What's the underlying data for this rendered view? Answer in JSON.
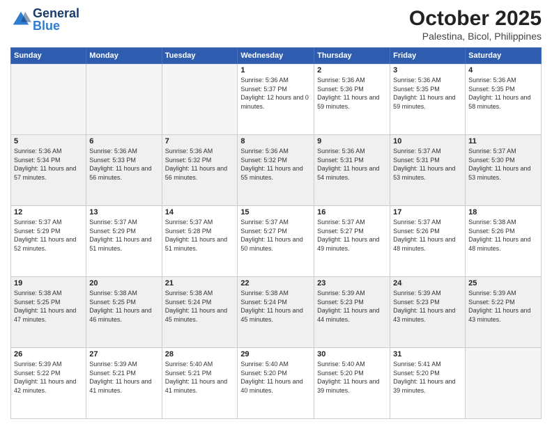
{
  "header": {
    "logo_general": "General",
    "logo_blue": "Blue",
    "month_title": "October 2025",
    "location": "Palestina, Bicol, Philippines"
  },
  "days_of_week": [
    "Sunday",
    "Monday",
    "Tuesday",
    "Wednesday",
    "Thursday",
    "Friday",
    "Saturday"
  ],
  "weeks": [
    [
      {
        "day": "",
        "sunrise": "",
        "sunset": "",
        "daylight": ""
      },
      {
        "day": "",
        "sunrise": "",
        "sunset": "",
        "daylight": ""
      },
      {
        "day": "",
        "sunrise": "",
        "sunset": "",
        "daylight": ""
      },
      {
        "day": "1",
        "sunrise": "Sunrise: 5:36 AM",
        "sunset": "Sunset: 5:37 PM",
        "daylight": "Daylight: 12 hours and 0 minutes."
      },
      {
        "day": "2",
        "sunrise": "Sunrise: 5:36 AM",
        "sunset": "Sunset: 5:36 PM",
        "daylight": "Daylight: 11 hours and 59 minutes."
      },
      {
        "day": "3",
        "sunrise": "Sunrise: 5:36 AM",
        "sunset": "Sunset: 5:35 PM",
        "daylight": "Daylight: 11 hours and 59 minutes."
      },
      {
        "day": "4",
        "sunrise": "Sunrise: 5:36 AM",
        "sunset": "Sunset: 5:35 PM",
        "daylight": "Daylight: 11 hours and 58 minutes."
      }
    ],
    [
      {
        "day": "5",
        "sunrise": "Sunrise: 5:36 AM",
        "sunset": "Sunset: 5:34 PM",
        "daylight": "Daylight: 11 hours and 57 minutes."
      },
      {
        "day": "6",
        "sunrise": "Sunrise: 5:36 AM",
        "sunset": "Sunset: 5:33 PM",
        "daylight": "Daylight: 11 hours and 56 minutes."
      },
      {
        "day": "7",
        "sunrise": "Sunrise: 5:36 AM",
        "sunset": "Sunset: 5:32 PM",
        "daylight": "Daylight: 11 hours and 56 minutes."
      },
      {
        "day": "8",
        "sunrise": "Sunrise: 5:36 AM",
        "sunset": "Sunset: 5:32 PM",
        "daylight": "Daylight: 11 hours and 55 minutes."
      },
      {
        "day": "9",
        "sunrise": "Sunrise: 5:36 AM",
        "sunset": "Sunset: 5:31 PM",
        "daylight": "Daylight: 11 hours and 54 minutes."
      },
      {
        "day": "10",
        "sunrise": "Sunrise: 5:37 AM",
        "sunset": "Sunset: 5:31 PM",
        "daylight": "Daylight: 11 hours and 53 minutes."
      },
      {
        "day": "11",
        "sunrise": "Sunrise: 5:37 AM",
        "sunset": "Sunset: 5:30 PM",
        "daylight": "Daylight: 11 hours and 53 minutes."
      }
    ],
    [
      {
        "day": "12",
        "sunrise": "Sunrise: 5:37 AM",
        "sunset": "Sunset: 5:29 PM",
        "daylight": "Daylight: 11 hours and 52 minutes."
      },
      {
        "day": "13",
        "sunrise": "Sunrise: 5:37 AM",
        "sunset": "Sunset: 5:29 PM",
        "daylight": "Daylight: 11 hours and 51 minutes."
      },
      {
        "day": "14",
        "sunrise": "Sunrise: 5:37 AM",
        "sunset": "Sunset: 5:28 PM",
        "daylight": "Daylight: 11 hours and 51 minutes."
      },
      {
        "day": "15",
        "sunrise": "Sunrise: 5:37 AM",
        "sunset": "Sunset: 5:27 PM",
        "daylight": "Daylight: 11 hours and 50 minutes."
      },
      {
        "day": "16",
        "sunrise": "Sunrise: 5:37 AM",
        "sunset": "Sunset: 5:27 PM",
        "daylight": "Daylight: 11 hours and 49 minutes."
      },
      {
        "day": "17",
        "sunrise": "Sunrise: 5:37 AM",
        "sunset": "Sunset: 5:26 PM",
        "daylight": "Daylight: 11 hours and 48 minutes."
      },
      {
        "day": "18",
        "sunrise": "Sunrise: 5:38 AM",
        "sunset": "Sunset: 5:26 PM",
        "daylight": "Daylight: 11 hours and 48 minutes."
      }
    ],
    [
      {
        "day": "19",
        "sunrise": "Sunrise: 5:38 AM",
        "sunset": "Sunset: 5:25 PM",
        "daylight": "Daylight: 11 hours and 47 minutes."
      },
      {
        "day": "20",
        "sunrise": "Sunrise: 5:38 AM",
        "sunset": "Sunset: 5:25 PM",
        "daylight": "Daylight: 11 hours and 46 minutes."
      },
      {
        "day": "21",
        "sunrise": "Sunrise: 5:38 AM",
        "sunset": "Sunset: 5:24 PM",
        "daylight": "Daylight: 11 hours and 45 minutes."
      },
      {
        "day": "22",
        "sunrise": "Sunrise: 5:38 AM",
        "sunset": "Sunset: 5:24 PM",
        "daylight": "Daylight: 11 hours and 45 minutes."
      },
      {
        "day": "23",
        "sunrise": "Sunrise: 5:39 AM",
        "sunset": "Sunset: 5:23 PM",
        "daylight": "Daylight: 11 hours and 44 minutes."
      },
      {
        "day": "24",
        "sunrise": "Sunrise: 5:39 AM",
        "sunset": "Sunset: 5:23 PM",
        "daylight": "Daylight: 11 hours and 43 minutes."
      },
      {
        "day": "25",
        "sunrise": "Sunrise: 5:39 AM",
        "sunset": "Sunset: 5:22 PM",
        "daylight": "Daylight: 11 hours and 43 minutes."
      }
    ],
    [
      {
        "day": "26",
        "sunrise": "Sunrise: 5:39 AM",
        "sunset": "Sunset: 5:22 PM",
        "daylight": "Daylight: 11 hours and 42 minutes."
      },
      {
        "day": "27",
        "sunrise": "Sunrise: 5:39 AM",
        "sunset": "Sunset: 5:21 PM",
        "daylight": "Daylight: 11 hours and 41 minutes."
      },
      {
        "day": "28",
        "sunrise": "Sunrise: 5:40 AM",
        "sunset": "Sunset: 5:21 PM",
        "daylight": "Daylight: 11 hours and 41 minutes."
      },
      {
        "day": "29",
        "sunrise": "Sunrise: 5:40 AM",
        "sunset": "Sunset: 5:20 PM",
        "daylight": "Daylight: 11 hours and 40 minutes."
      },
      {
        "day": "30",
        "sunrise": "Sunrise: 5:40 AM",
        "sunset": "Sunset: 5:20 PM",
        "daylight": "Daylight: 11 hours and 39 minutes."
      },
      {
        "day": "31",
        "sunrise": "Sunrise: 5:41 AM",
        "sunset": "Sunset: 5:20 PM",
        "daylight": "Daylight: 11 hours and 39 minutes."
      },
      {
        "day": "",
        "sunrise": "",
        "sunset": "",
        "daylight": ""
      }
    ]
  ]
}
